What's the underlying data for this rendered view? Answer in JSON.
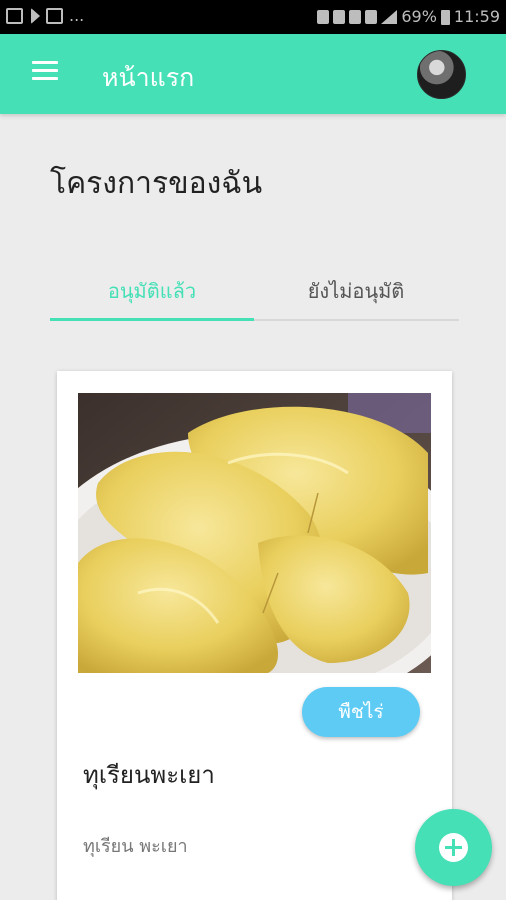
{
  "status_bar": {
    "dots": "...",
    "battery": "69%",
    "time": "11:59"
  },
  "toolbar": {
    "title": "หน้าแรก",
    "icons": {
      "menu": "hamburger-menu-icon",
      "avatar": "user-avatar"
    }
  },
  "page": {
    "title": "โครงการของฉัน"
  },
  "tabs": [
    {
      "label": "อนุมัติแล้ว",
      "active": true
    },
    {
      "label": "ยังไม่อนุมัติ",
      "active": false
    }
  ],
  "projects": [
    {
      "image": "durian-photo",
      "tag": "พืชไร่",
      "name": "ทุเรียนพะเยา",
      "description": "ทุเรียน พะเยา"
    }
  ],
  "fab": {
    "icon": "add-circle-icon"
  },
  "colors": {
    "primary": "#45e0b6",
    "chip": "#5ecbf5",
    "background": "#ececec"
  }
}
